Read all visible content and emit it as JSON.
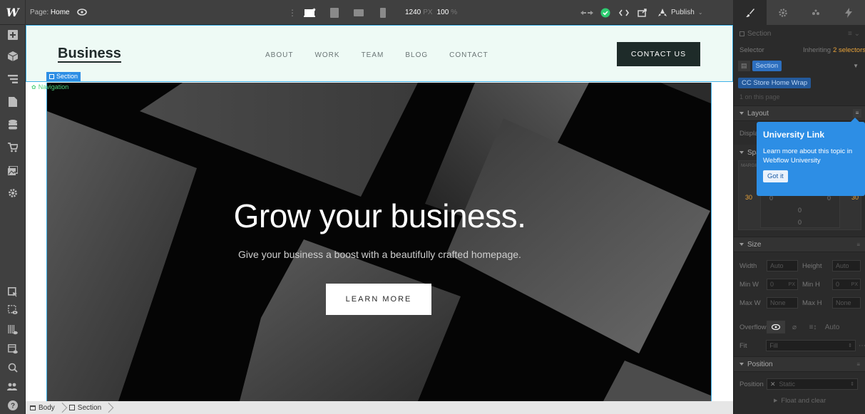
{
  "app": {
    "logo_letter": "W",
    "page_label": "Page:",
    "page_name": "Home"
  },
  "toolbar": {
    "viewport_width": "1240",
    "viewport_unit": "PX",
    "zoom": "100",
    "zoom_unit": "%",
    "publish_label": "Publish"
  },
  "site": {
    "brand": "Business",
    "nav_links": [
      "ABOUT",
      "WORK",
      "TEAM",
      "BLOG",
      "CONTACT"
    ],
    "nav_cta": "CONTACT US",
    "hero_title": "Grow your business.",
    "hero_subtitle": "Give your business a boost with a beautifully crafted homepage.",
    "hero_button": "LEARN MORE"
  },
  "canvas_tags": {
    "selected": "Section",
    "navigation": "Navigation"
  },
  "breadcrumb": [
    "Body",
    "Section"
  ],
  "style_panel": {
    "element_name": "Section",
    "selector_label": "Selector",
    "inheriting": "Inheriting",
    "inheriting_count": "2 selectors",
    "selector_pill": "Section",
    "class_pill": "CC Store Home Wrap",
    "on_page": "1 on this page",
    "layout_header": "Layout",
    "display_label": "Display",
    "spacing_header": "Spacing",
    "margin_label": "MARGIN",
    "margin_left": "30",
    "margin_right": "30",
    "padding_values": [
      "0",
      "0",
      "0",
      "0"
    ],
    "size_header": "Size",
    "width_label": "Width",
    "width_value": "Auto",
    "height_label": "Height",
    "height_value": "Auto",
    "minw_label": "Min W",
    "minw_value": "0",
    "minw_unit": "PX",
    "minh_label": "Min H",
    "minh_value": "0",
    "minh_unit": "PX",
    "maxw_label": "Max W",
    "maxw_value": "None",
    "maxh_label": "Max H",
    "maxh_value": "None",
    "overflow_label": "Overflow",
    "overflow_auto": "Auto",
    "fit_label": "Fit",
    "fit_value": "Fill",
    "position_header": "Position",
    "position_label": "Position",
    "position_value": "Static",
    "float_clear": "Float and clear"
  },
  "popover": {
    "title": "University Link",
    "body": "Learn more about this topic in Webflow University",
    "button": "Got it"
  },
  "colors": {
    "accent_blue": "#2d8ee5",
    "nav_bg": "#eefaf5",
    "publish_green": "#2ecc71",
    "cta_dark": "#1e2b29"
  }
}
